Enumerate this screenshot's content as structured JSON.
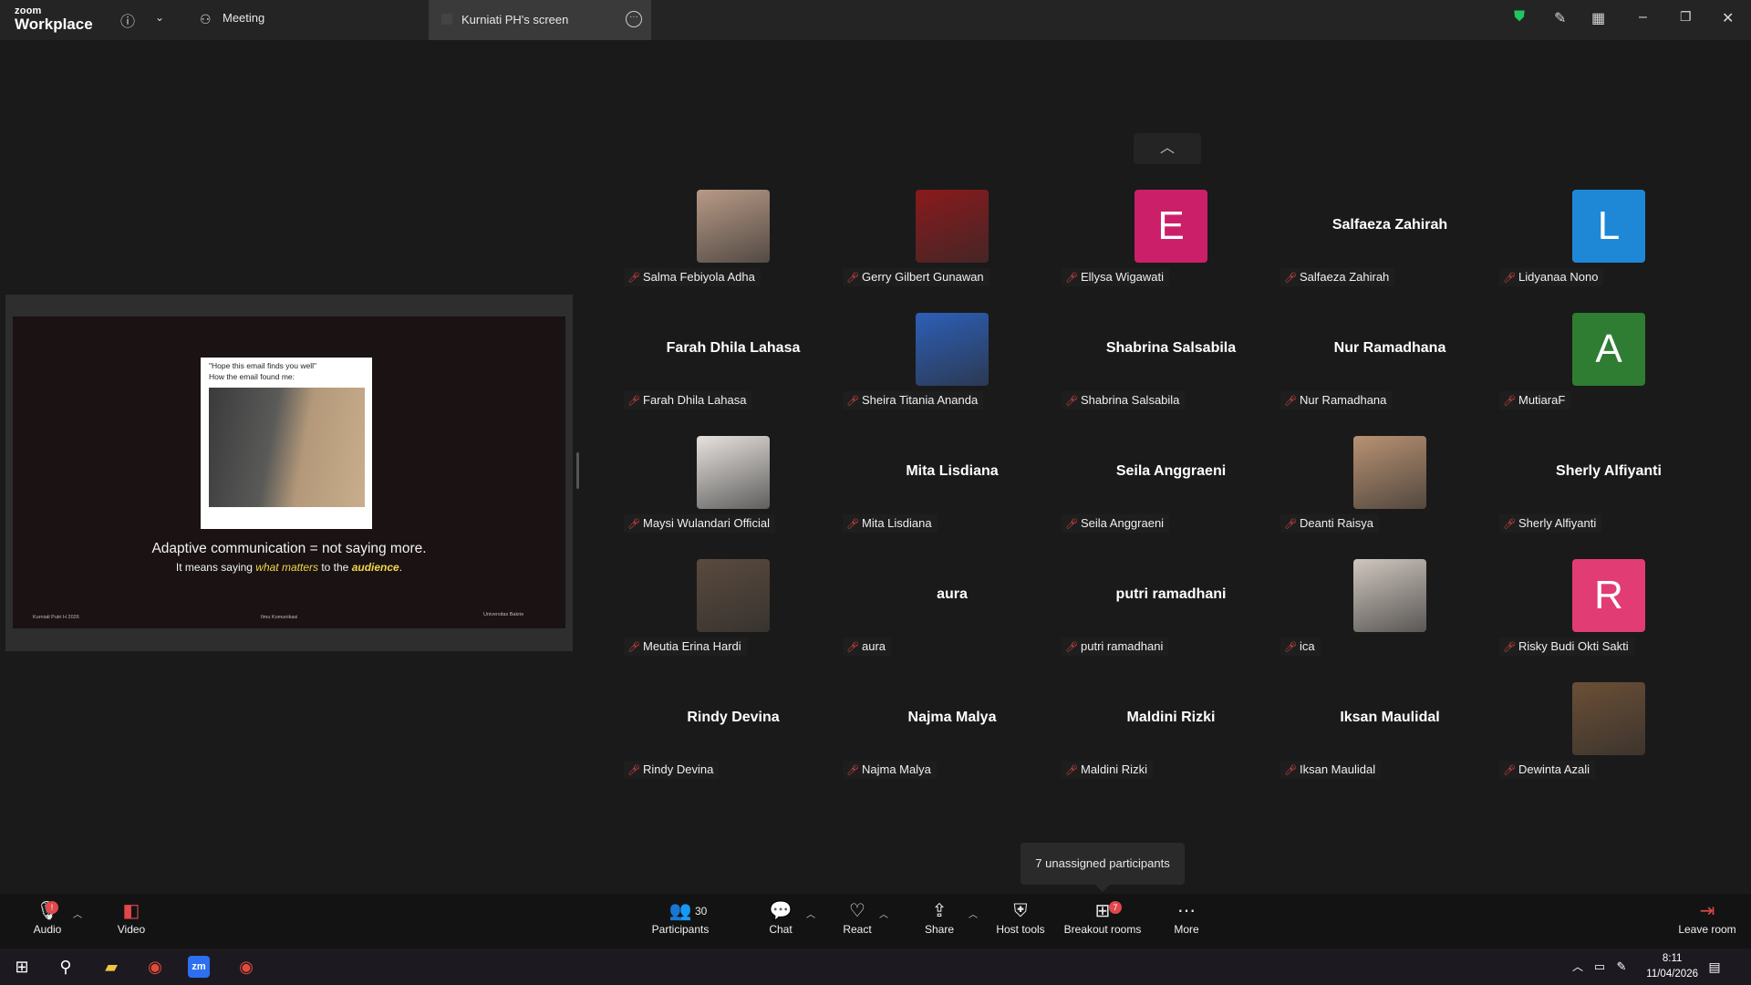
{
  "titlebar": {
    "logo_top": "zoom",
    "logo_bottom": "Workplace",
    "meeting_tab": "Meeting",
    "screen_tab": "Kurniati PH's screen"
  },
  "slide": {
    "meme_line1": "\"Hope this email finds you well\"",
    "meme_line2": "How the email found me:",
    "heading": "Adaptive communication = not saying more.",
    "sub_prefix": "It means saying ",
    "sub_em": "what matters",
    "sub_mid": " to the ",
    "sub_bold": "audience",
    "sub_end": ".",
    "footer_left": "Kurniati Putri H 2026",
    "footer_center": "Ilmu Komunikasi",
    "footer_right": "Universitas Bakrie"
  },
  "participants": [
    {
      "name": "Salma Febiyola Adha",
      "kind": "photo",
      "photo": "#b89a86"
    },
    {
      "name": "Gerry Gilbert Gunawan",
      "kind": "photo",
      "photo": "#8a1a1c"
    },
    {
      "name": "Ellysa Wigawati",
      "kind": "letter",
      "letter": "E",
      "color": "#cc1f6a"
    },
    {
      "name": "Salfaeza Zahirah",
      "kind": "text",
      "display": "Salfaeza Zahirah"
    },
    {
      "name": "Lidyanaa Nono",
      "kind": "letter",
      "letter": "L",
      "color": "#1e88d6"
    },
    {
      "name": "Farah Dhila Lahasa",
      "kind": "text",
      "display": "Farah Dhila Lahasa"
    },
    {
      "name": "Sheira Titania Ananda",
      "kind": "photo",
      "photo": "#2d5fb8"
    },
    {
      "name": "Shabrina Salsabila",
      "kind": "text",
      "display": "Shabrina Salsabila"
    },
    {
      "name": "Nur Ramadhana",
      "kind": "text",
      "display": "Nur Ramadhana"
    },
    {
      "name": "MutiaraF",
      "kind": "letter",
      "letter": "A",
      "color": "#2e7d32"
    },
    {
      "name": "Maysi Wulandari Official",
      "kind": "photo",
      "photo": "#e6e2de"
    },
    {
      "name": "Mita Lisdiana",
      "kind": "text",
      "display": "Mita Lisdiana"
    },
    {
      "name": "Seila Anggraeni",
      "kind": "text",
      "display": "Seila Anggraeni"
    },
    {
      "name": "Deanti Raisya",
      "kind": "photo",
      "photo": "#b89272"
    },
    {
      "name": "Sherly Alfiyanti",
      "kind": "text",
      "display": "Sherly Alfiyanti"
    },
    {
      "name": "Meutia Erina Hardi",
      "kind": "photo",
      "photo": "#5a4a3e"
    },
    {
      "name": "aura",
      "kind": "text",
      "display": "aura"
    },
    {
      "name": "putri ramadhani",
      "kind": "text",
      "display": "putri ramadhani"
    },
    {
      "name": "ica",
      "kind": "photo",
      "photo": "#cfc6be"
    },
    {
      "name": "Risky Budi Okti Sakti",
      "kind": "letter",
      "letter": "R",
      "color": "#e23c74"
    },
    {
      "name": "Rindy Devina",
      "kind": "text",
      "display": "Rindy Devina"
    },
    {
      "name": "Najma Malya",
      "kind": "text",
      "display": "Najma Malya"
    },
    {
      "name": "Maldini Rizki",
      "kind": "text",
      "display": "Maldini Rizki"
    },
    {
      "name": "Iksan Maulidal",
      "kind": "text",
      "display": "Iksan Maulidal"
    },
    {
      "name": "Dewinta Azali",
      "kind": "photo",
      "photo": "#6b4f36"
    }
  ],
  "unassigned": "7 unassigned participants",
  "toolbar": {
    "audio": "Audio",
    "video": "Video",
    "participants": "Participants",
    "participants_count": "30",
    "chat": "Chat",
    "react": "React",
    "share": "Share",
    "host_tools": "Host tools",
    "breakout": "Breakout rooms",
    "breakout_badge": "7",
    "more": "More",
    "leave": "Leave room"
  },
  "taskbar": {
    "time": "8:11",
    "date": "11/04/2026"
  }
}
